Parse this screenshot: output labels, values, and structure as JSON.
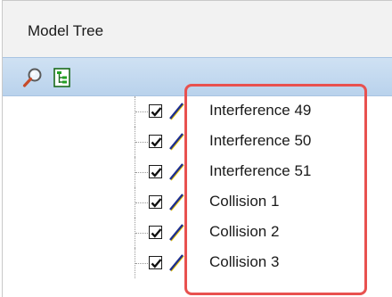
{
  "panel": {
    "title": "Model Tree",
    "toolbar": {
      "buttons": [
        {
          "icon": "search-icon"
        },
        {
          "icon": "tree-view-icon"
        }
      ]
    }
  },
  "tree": {
    "items": [
      {
        "label": "Interference 49",
        "checked": true,
        "icon": "interference-line-icon"
      },
      {
        "label": "Interference 50",
        "checked": true,
        "icon": "interference-line-icon"
      },
      {
        "label": "Interference 51",
        "checked": true,
        "icon": "interference-line-icon"
      },
      {
        "label": "Collision 1",
        "checked": true,
        "icon": "collision-line-icon"
      },
      {
        "label": "Collision 2",
        "checked": true,
        "icon": "collision-line-icon"
      },
      {
        "label": "Collision 3",
        "checked": true,
        "icon": "collision-line-icon"
      }
    ]
  },
  "colors": {
    "highlight": "#e8514f",
    "toolbar": "#c4d9ef",
    "accent_line": "#1e2f8c"
  }
}
